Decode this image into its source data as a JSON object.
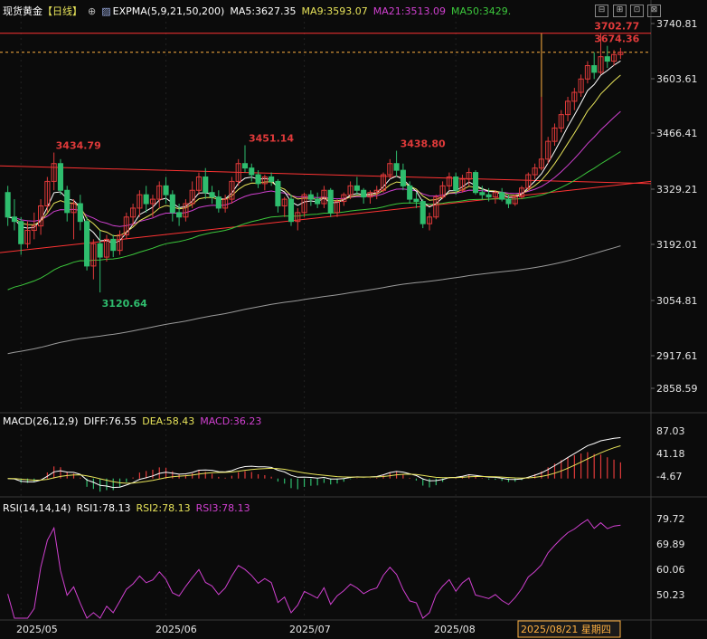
{
  "header": {
    "symbol": "现货黄金",
    "period": "【日线】",
    "indicator_name": "EXPMA(5,9,21,50,200)",
    "ma5": "MA5:3627.35",
    "ma9": "MA9:3593.07",
    "ma21": "MA21:3513.09",
    "ma50": "MA50:3429.",
    "settings_icon": "crosshair-icon"
  },
  "window_buttons": [
    "minimize-icon",
    "restore-icon",
    "maximize-icon",
    "close-icon"
  ],
  "colors": {
    "background": "#0b0b0b",
    "up": "#e03a3a",
    "down": "#2fbd6e",
    "ma5": "#ffffff",
    "ma9": "#e8e45a",
    "ma21": "#d040d0",
    "ma50": "#3cc83c",
    "ma200": "#9a9a9a",
    "trendline": "#ff3333"
  },
  "price_axis": [
    "3740.81",
    "3603.61",
    "3466.41",
    "3329.21",
    "3192.01",
    "3054.81",
    "2917.61",
    "2858.59"
  ],
  "annotations": {
    "high_3702": "3702.77",
    "high_3674": "3674.36",
    "peak_a": "3434.79",
    "peak_b": "3451.14",
    "peak_c": "3438.80",
    "low_a": "3120.64"
  },
  "macd": {
    "title": "MACD(26,12,9)",
    "diff": "DIFF:76.55",
    "dea": "DEA:58.43",
    "macd": "MACD:36.23",
    "axis": [
      "87.03",
      "41.18",
      "-4.67"
    ]
  },
  "rsi": {
    "title": "RSI(14,14,14)",
    "rsi1": "RSI1:78.13",
    "rsi2": "RSI2:78.13",
    "rsi3": "RSI3:78.13",
    "axis": [
      "79.72",
      "69.89",
      "60.06",
      "50.23"
    ]
  },
  "time_axis": {
    "labels": [
      "2025/05",
      "2025/06",
      "2025/07",
      "2025/08"
    ],
    "cursor_label": "2025/08/21 星期四"
  },
  "chart_data": {
    "type": "candlestick",
    "series_order": "open, high, low, close per trading day from 2025-04-29 to 2025-08-21",
    "candles": [
      [
        3345,
        3360,
        3270,
        3290
      ],
      [
        3290,
        3330,
        3260,
        3280
      ],
      [
        3280,
        3290,
        3205,
        3230
      ],
      [
        3230,
        3280,
        3220,
        3260
      ],
      [
        3260,
        3300,
        3240,
        3270
      ],
      [
        3270,
        3330,
        3250,
        3315
      ],
      [
        3315,
        3380,
        3300,
        3370
      ],
      [
        3370,
        3434.79,
        3350,
        3410
      ],
      [
        3410,
        3420,
        3340,
        3350
      ],
      [
        3350,
        3360,
        3280,
        3300
      ],
      [
        3300,
        3330,
        3240,
        3320
      ],
      [
        3320,
        3340,
        3260,
        3280
      ],
      [
        3280,
        3290,
        3170,
        3180
      ],
      [
        3180,
        3240,
        3150,
        3230
      ],
      [
        3230,
        3260,
        3120.64,
        3200
      ],
      [
        3200,
        3250,
        3190,
        3240
      ],
      [
        3240,
        3250,
        3200,
        3215
      ],
      [
        3215,
        3260,
        3205,
        3250
      ],
      [
        3250,
        3300,
        3240,
        3290
      ],
      [
        3290,
        3320,
        3270,
        3310
      ],
      [
        3310,
        3350,
        3290,
        3340
      ],
      [
        3340,
        3360,
        3300,
        3320
      ],
      [
        3320,
        3340,
        3290,
        3330
      ],
      [
        3330,
        3370,
        3310,
        3360
      ],
      [
        3360,
        3380,
        3320,
        3340
      ],
      [
        3340,
        3350,
        3280,
        3300
      ],
      [
        3300,
        3320,
        3270,
        3290
      ],
      [
        3290,
        3330,
        3280,
        3320
      ],
      [
        3320,
        3370,
        3310,
        3350
      ],
      [
        3350,
        3390,
        3340,
        3380
      ],
      [
        3380,
        3400,
        3330,
        3345
      ],
      [
        3345,
        3360,
        3320,
        3335
      ],
      [
        3335,
        3350,
        3300,
        3310
      ],
      [
        3310,
        3340,
        3300,
        3330
      ],
      [
        3330,
        3380,
        3320,
        3370
      ],
      [
        3370,
        3420,
        3360,
        3410
      ],
      [
        3410,
        3451.14,
        3390,
        3400
      ],
      [
        3400,
        3410,
        3370,
        3385
      ],
      [
        3385,
        3395,
        3355,
        3365
      ],
      [
        3365,
        3385,
        3350,
        3380
      ],
      [
        3380,
        3390,
        3360,
        3370
      ],
      [
        3370,
        3375,
        3300,
        3315
      ],
      [
        3315,
        3335,
        3290,
        3330
      ],
      [
        3330,
        3340,
        3270,
        3280
      ],
      [
        3280,
        3310,
        3260,
        3300
      ],
      [
        3300,
        3345,
        3290,
        3340
      ],
      [
        3340,
        3350,
        3315,
        3330
      ],
      [
        3330,
        3345,
        3310,
        3320
      ],
      [
        3320,
        3360,
        3310,
        3350
      ],
      [
        3350,
        3355,
        3290,
        3300
      ],
      [
        3300,
        3330,
        3290,
        3325
      ],
      [
        3325,
        3345,
        3315,
        3340
      ],
      [
        3340,
        3370,
        3330,
        3360
      ],
      [
        3360,
        3380,
        3340,
        3350
      ],
      [
        3350,
        3355,
        3320,
        3335
      ],
      [
        3335,
        3350,
        3320,
        3345
      ],
      [
        3345,
        3360,
        3330,
        3350
      ],
      [
        3350,
        3390,
        3345,
        3385
      ],
      [
        3385,
        3420,
        3375,
        3410
      ],
      [
        3410,
        3438.8,
        3380,
        3395
      ],
      [
        3395,
        3410,
        3350,
        3360
      ],
      [
        3360,
        3370,
        3320,
        3330
      ],
      [
        3330,
        3345,
        3310,
        3325
      ],
      [
        3325,
        3330,
        3265,
        3275
      ],
      [
        3275,
        3300,
        3260,
        3290
      ],
      [
        3290,
        3340,
        3285,
        3335
      ],
      [
        3335,
        3370,
        3330,
        3360
      ],
      [
        3360,
        3390,
        3350,
        3380
      ],
      [
        3380,
        3390,
        3340,
        3350
      ],
      [
        3350,
        3385,
        3345,
        3375
      ],
      [
        3375,
        3400,
        3360,
        3390
      ],
      [
        3390,
        3395,
        3340,
        3345
      ],
      [
        3345,
        3360,
        3330,
        3340
      ],
      [
        3340,
        3355,
        3325,
        3335
      ],
      [
        3335,
        3350,
        3320,
        3345
      ],
      [
        3345,
        3355,
        3325,
        3330
      ],
      [
        3330,
        3340,
        3310,
        3320
      ],
      [
        3320,
        3340,
        3315,
        3335
      ],
      [
        3335,
        3360,
        3330,
        3355
      ],
      [
        3355,
        3390,
        3350,
        3385
      ],
      [
        3385,
        3410,
        3375,
        3400
      ],
      [
        3400,
        3560,
        3395,
        3420
      ],
      [
        3420,
        3470,
        3410,
        3460
      ],
      [
        3460,
        3500,
        3450,
        3490
      ],
      [
        3490,
        3530,
        3480,
        3520
      ],
      [
        3520,
        3560,
        3505,
        3550
      ],
      [
        3550,
        3580,
        3530,
        3570
      ],
      [
        3570,
        3610,
        3560,
        3600
      ],
      [
        3600,
        3640,
        3590,
        3630
      ],
      [
        3630,
        3660,
        3600,
        3615
      ],
      [
        3615,
        3702.77,
        3610,
        3650
      ],
      [
        3650,
        3674.36,
        3625,
        3640
      ],
      [
        3640,
        3665,
        3630,
        3655
      ],
      [
        3655,
        3670,
        3645,
        3660
      ]
    ],
    "price_range": [
      2858.59,
      3740.81
    ],
    "macd_range": [
      -20,
      95
    ],
    "rsi_range": [
      40,
      82
    ]
  }
}
